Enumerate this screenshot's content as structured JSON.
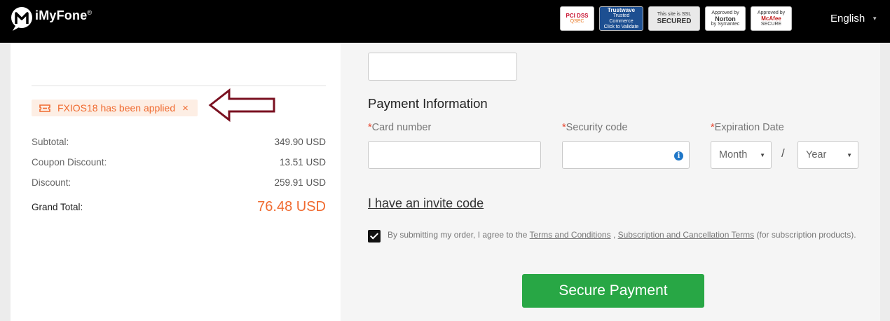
{
  "header": {
    "brand": "iMyFone",
    "brand_mark": "®",
    "language": "English",
    "badges": [
      {
        "icon": "pci-dss-badge",
        "line1": "PCI DSS",
        "line2": "QSEC"
      },
      {
        "icon": "trustwave-badge",
        "line1": "Trustwave",
        "line2": "Trusted Commerce",
        "line3": "Click to Validate"
      },
      {
        "icon": "ssl-secured-badge",
        "line1": "This site is SSL",
        "line2": "SECURED"
      },
      {
        "icon": "norton-badge",
        "line1": "Approved by",
        "line2": "Norton",
        "line3": "by Symantec"
      },
      {
        "icon": "mcafee-badge",
        "line1": "Approved by",
        "line2": "McAfee",
        "line3": "SECURE"
      }
    ]
  },
  "order_summary": {
    "coupon_text": "FXIOS18 has been applied",
    "coupon_close": "×",
    "rows": [
      {
        "label": "Subtotal:",
        "value": "349.90 USD"
      },
      {
        "label": "Coupon Discount:",
        "value": "13.51 USD"
      },
      {
        "label": "Discount:",
        "value": "259.91 USD"
      }
    ],
    "grand_total_label": "Grand Total:",
    "grand_total_value": "76.48 USD"
  },
  "payment": {
    "title": "Payment Information",
    "required_mark": "*",
    "card_number_label": "Card number",
    "security_code_label": "Security code",
    "expiration_label": "Expiration Date",
    "month_placeholder": "Month",
    "year_placeholder": "Year",
    "date_separator": "/",
    "info_icon_glyph": "i",
    "invite_code": "I have an invite code",
    "terms_prefix": "By submitting my order, I agree to the ",
    "terms_link": "Terms and Conditions",
    "terms_sep": " , ",
    "subscription_link": "Subscription and Cancellation Terms",
    "terms_suffix": " (for subscription products).",
    "agree_checked": true,
    "submit_label": "Secure Payment"
  },
  "colors": {
    "accent": "#f06a2f",
    "pay_button": "#28a745",
    "arrow": "#7a1020"
  }
}
